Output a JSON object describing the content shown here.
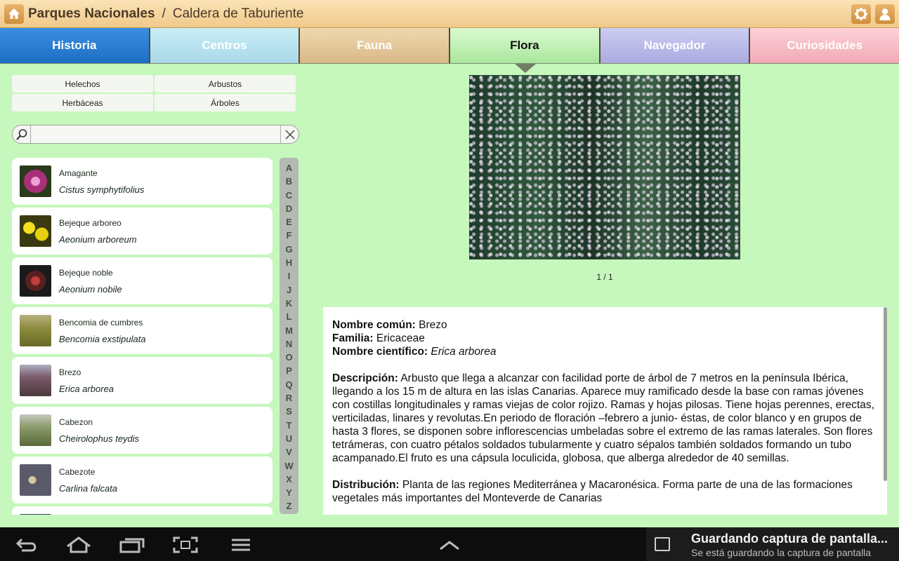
{
  "header": {
    "app_title": "Parques Nacionales",
    "separator": "/",
    "park_name": "Caldera de Taburiente"
  },
  "icons": {
    "home": "home-icon",
    "settings": "gear-icon",
    "profile": "user-icon"
  },
  "tabs": [
    {
      "label": "Historia"
    },
    {
      "label": "Centros"
    },
    {
      "label": "Fauna"
    },
    {
      "label": "Flora",
      "selected": true
    },
    {
      "label": "Navegador"
    },
    {
      "label": "Curiosidades"
    }
  ],
  "filters": [
    "Helechos",
    "Arbustos",
    "Herbáceas",
    "Árboles"
  ],
  "search": {
    "value": "",
    "placeholder": ""
  },
  "plants": [
    {
      "common": "Amagante",
      "scientific": "Cistus symphytifolius",
      "thumb_color": "#b03a8a"
    },
    {
      "common": "Bejeque arboreo",
      "scientific": "Aeonium arboreum",
      "thumb_color": "#e0d020"
    },
    {
      "common": "Bejeque noble",
      "scientific": "Aeonium nobile",
      "thumb_color": "#7a2a2a"
    },
    {
      "common": "Bencomia de cumbres",
      "scientific": "Bencomia exstipulata",
      "thumb_color": "#8a8a3a"
    },
    {
      "common": "Brezo",
      "scientific": "Erica arborea",
      "thumb_color": "#6a5a6a"
    },
    {
      "common": "Cabezon",
      "scientific": "Cheirolophus teydis",
      "thumb_color": "#7a8a5a"
    },
    {
      "common": "Cabezote",
      "scientific": "Carlina falcata",
      "thumb_color": "#5a5a6a"
    },
    {
      "common": "",
      "scientific": "",
      "thumb_color": "#2a4a6a"
    }
  ],
  "alphabet": [
    "A",
    "B",
    "C",
    "D",
    "E",
    "F",
    "G",
    "H",
    "I",
    "J",
    "K",
    "L",
    "M",
    "N",
    "O",
    "P",
    "Q",
    "R",
    "S",
    "T",
    "U",
    "V",
    "W",
    "X",
    "Y",
    "Z"
  ],
  "detail": {
    "counter": "1 / 1",
    "common_label": "Nombre común:",
    "common_value": "Brezo",
    "family_label": "Familia:",
    "family_value": "Ericaceae",
    "scientific_label": "Nombre científico:",
    "scientific_value": "Erica arborea",
    "description_label": "Descripción:",
    "description_text": "Arbusto que llega a alcanzar con facilidad porte de árbol de 7 metros en la península Ibérica, llegando a los 15 m de altura en las islas Canarias. Aparece muy ramificado desde la base con ramas jóvenes con costillas longitudinales y ramas viejas de color rojizo. Ramas y hojas pilosas. Tiene hojas perennes, erectas, verticiladas, linares y revolutas.En periodo de floración –febrero a junio- éstas, de color blanco y en grupos de hasta 3 flores, se disponen sobre inflorescencias umbeladas sobre el extremo de las ramas laterales. Son flores tetrámeras, con cuatro pétalos soldados tubularmente y cuatro sépalos también soldados formando un tubo acampanado.El fruto es una cápsula loculicida, globosa, que alberga alrededor de 40 semillas.",
    "distribution_label": "Distribución:",
    "distribution_text": "Planta de las regiones Mediterránea y Macaronésica. Forma parte de una de las formaciones vegetales más importantes del Monteverde de Canarias"
  },
  "notification": {
    "title": "Guardando captura de pantalla...",
    "subtitle": "Se está guardando la captura de pantalla"
  }
}
